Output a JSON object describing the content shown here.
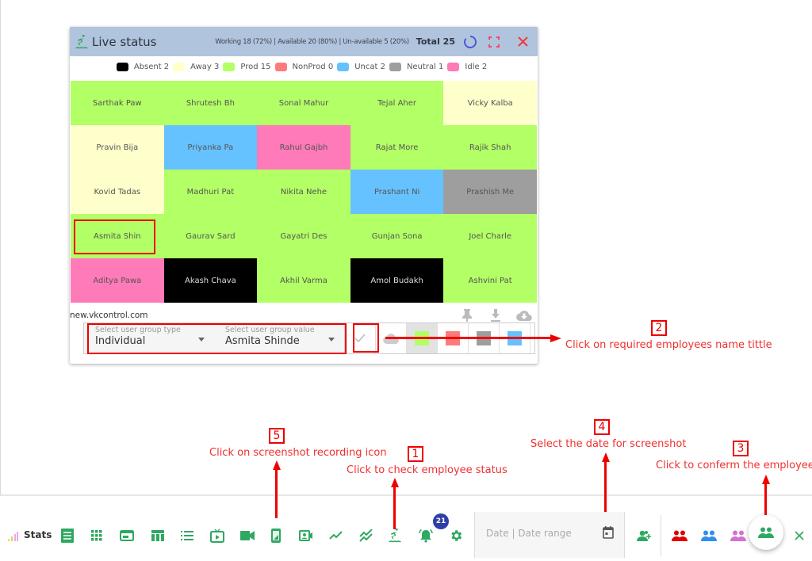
{
  "panel": {
    "title": "Live status",
    "stats_text": "Working 18 (72%) |  Available 20 (80%) |  Un-available 5 (20%)",
    "total_text": "Total 25",
    "domain": "new.vkcontrol.com"
  },
  "legend": [
    {
      "label": "Absent 2",
      "color": "#000000"
    },
    {
      "label": "Away 3",
      "color": "#ffffcc"
    },
    {
      "label": "Prod 15",
      "color": "#b3ff66"
    },
    {
      "label": "NonProd 0",
      "color": "#ff7b7b"
    },
    {
      "label": "Uncat 2",
      "color": "#66c2ff"
    },
    {
      "label": "Neutral 1",
      "color": "#9e9e9e"
    },
    {
      "label": "Idle 2",
      "color": "#ff7ab8"
    }
  ],
  "status_colors": {
    "absent": "#000000",
    "away": "#ffffcc",
    "prod": "#b3ff66",
    "nonprod": "#ff7b7b",
    "uncat": "#66c2ff",
    "neutral": "#9e9e9e",
    "idle": "#ff7ab8"
  },
  "employees": [
    {
      "name": "Sarthak Paw",
      "status": "prod"
    },
    {
      "name": "Shrutesh Bh",
      "status": "prod"
    },
    {
      "name": "Sonal Mahur",
      "status": "prod"
    },
    {
      "name": "Tejal Aher",
      "status": "prod"
    },
    {
      "name": "Vicky Kalba",
      "status": "away"
    },
    {
      "name": "Pravin Bija",
      "status": "away"
    },
    {
      "name": "Priyanka Pa",
      "status": "uncat"
    },
    {
      "name": "Rahul Gajbh",
      "status": "idle"
    },
    {
      "name": "Rajat More",
      "status": "prod"
    },
    {
      "name": "Rajik Shah",
      "status": "prod"
    },
    {
      "name": "Kovid Tadas",
      "status": "away"
    },
    {
      "name": "Madhuri Pat",
      "status": "prod"
    },
    {
      "name": "Nikita Nehe",
      "status": "prod"
    },
    {
      "name": "Prashant Ni",
      "status": "uncat"
    },
    {
      "name": "Prashish Me",
      "status": "neutral"
    },
    {
      "name": "Asmita Shin",
      "status": "prod"
    },
    {
      "name": "Gaurav Sard",
      "status": "prod"
    },
    {
      "name": "Gayatri Des",
      "status": "prod"
    },
    {
      "name": "Gunjan Sona",
      "status": "prod"
    },
    {
      "name": "Joel Charle",
      "status": "prod"
    },
    {
      "name": "Aditya Pawa",
      "status": "idle"
    },
    {
      "name": "Akash Chava",
      "status": "absent"
    },
    {
      "name": "Akhil Varma",
      "status": "prod"
    },
    {
      "name": "Amol Budakh",
      "status": "absent"
    },
    {
      "name": "Ashvini Pat",
      "status": "prod"
    }
  ],
  "controls": {
    "group_type_label": "Select user group type",
    "group_type_value": "Individual",
    "group_value_label": "Select user group value",
    "group_value_value": "Asmita Shinde",
    "filter_colors": [
      "#b3ff66",
      "#ff7b7b",
      "#9e9e9e",
      "#66c2ff"
    ]
  },
  "annotations": {
    "step1": {
      "num": "1",
      "text": "Click to check employee status"
    },
    "step2": {
      "num": "2",
      "text": "Click on required employees name tittle"
    },
    "step3": {
      "num": "3",
      "text": "Click to conferm the employee"
    },
    "step4": {
      "num": "4",
      "text": "Select the date for screenshot"
    },
    "step5": {
      "num": "5",
      "text": "Click on screenshot recording icon"
    }
  },
  "toolbar": {
    "stats_label": "Stats",
    "notification_count": "21",
    "date_placeholder": "Date | Date range",
    "group_colors": [
      "#e00000",
      "#2f8ef0",
      "#d470d4",
      "#2fa862"
    ],
    "accent": "#2fa862"
  }
}
